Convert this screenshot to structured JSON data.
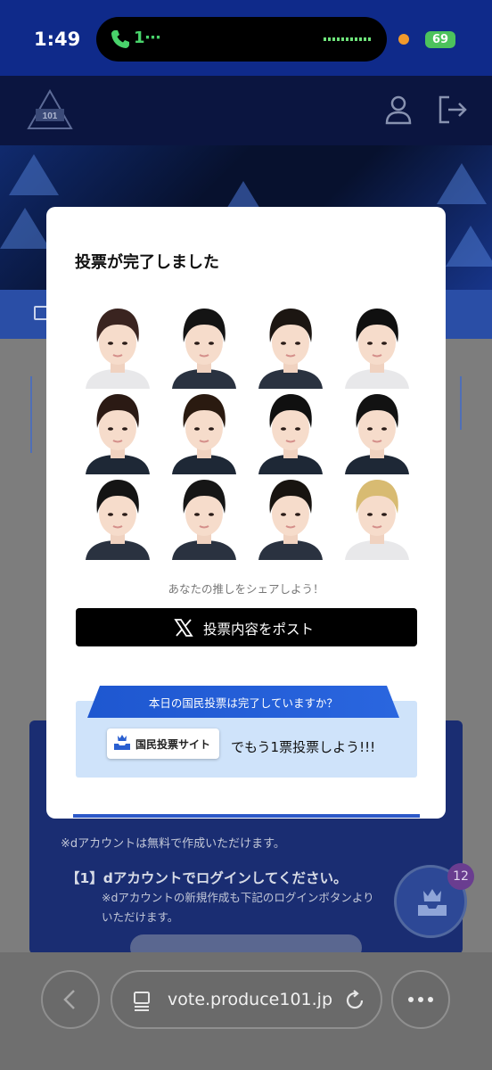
{
  "status_bar": {
    "time": "1:49",
    "call_label": "1⋯",
    "battery": "69",
    "call_icon": "phone-icon"
  },
  "site": {
    "logo_text": "PRODUCE 101",
    "icons": [
      "user-icon",
      "logout-icon",
      "play-icon"
    ],
    "background_note": "※dアカウントは無料で作成いただけます。",
    "background_step": "【1】dアカウントでログインしてください。",
    "background_sub_line1": "※dアカウントの新規作成も下記のログインボタンより",
    "background_sub_line2": "いただけます。",
    "vote_badge_count": "12"
  },
  "modal": {
    "title": "投票が完了しました",
    "share_prompt": "あなたの推しをシェアしよう！",
    "post_button_label": "投票内容をポスト",
    "national_vote_question": "本日の国民投票は完了していますか？",
    "national_vote_site_label": "国民投票サイト",
    "national_vote_cta": "でもう1票投票しよう!!!",
    "selected_trainees": [
      {
        "hair": "#3a2420",
        "shirt": "#e8e8ea"
      },
      {
        "hair": "#141414",
        "shirt": "#2a3240"
      },
      {
        "hair": "#1c1612",
        "shirt": "#2a3240"
      },
      {
        "hair": "#101010",
        "shirt": "#e8e8ea"
      },
      {
        "hair": "#2b1a14",
        "shirt": "#1e2836"
      },
      {
        "hair": "#2a1a10",
        "shirt": "#1e2836"
      },
      {
        "hair": "#101010",
        "shirt": "#1e2836"
      },
      {
        "hair": "#121212",
        "shirt": "#1e2836"
      },
      {
        "hair": "#141414",
        "shirt": "#2a3240"
      },
      {
        "hair": "#161616",
        "shirt": "#2a3240"
      },
      {
        "hair": "#181410",
        "shirt": "#2a3240"
      },
      {
        "hair": "#d8bb72",
        "shirt": "#e8e8ea"
      }
    ]
  },
  "browser": {
    "url": "vote.produce101.jp",
    "icons": [
      "back-icon",
      "tabs-icon",
      "reload-icon",
      "more-icon"
    ]
  },
  "colors": {
    "accent_blue": "#2c58c8",
    "vote_box": "#cfe3fa",
    "post_button": "#000000"
  }
}
